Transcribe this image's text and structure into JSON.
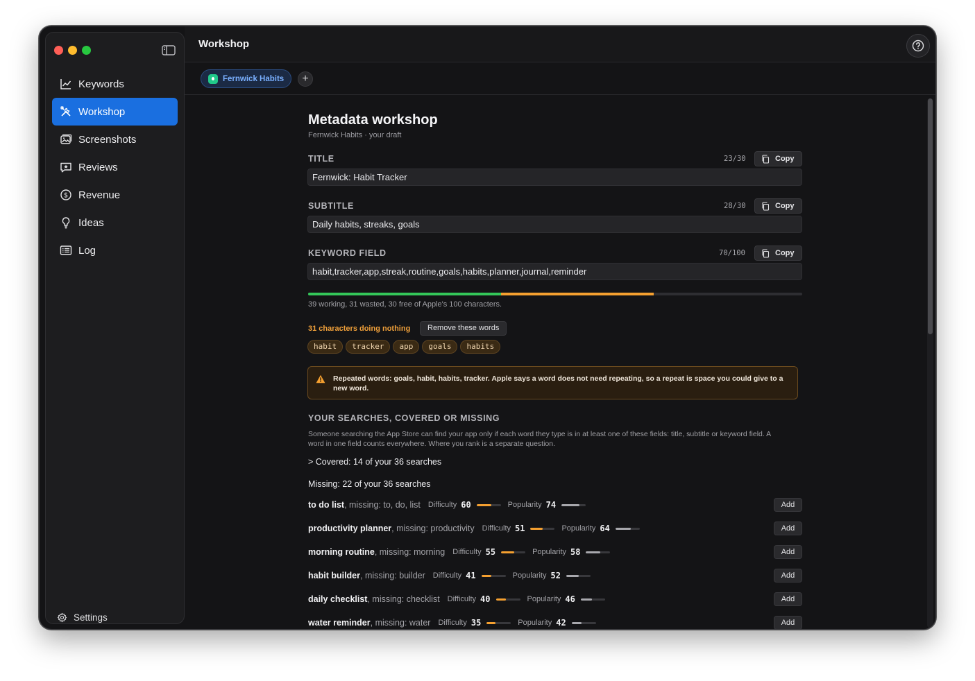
{
  "window": {
    "header_title": "Workshop"
  },
  "sidebar": {
    "items": [
      {
        "label": "Keywords",
        "icon": "chart-line-icon"
      },
      {
        "label": "Workshop",
        "icon": "tools-icon"
      },
      {
        "label": "Screenshots",
        "icon": "photos-icon"
      },
      {
        "label": "Reviews",
        "icon": "star-bubble-icon"
      },
      {
        "label": "Revenue",
        "icon": "dollar-circle-icon"
      },
      {
        "label": "Ideas",
        "icon": "lightbulb-icon"
      },
      {
        "label": "Log",
        "icon": "list-icon"
      }
    ],
    "active": "Workshop",
    "settings_label": "Settings"
  },
  "tabs": {
    "app_tab_label": "Fernwick Habits",
    "add_label": "+"
  },
  "workshop": {
    "title": "Metadata workshop",
    "subtitle": "Fernwick Habits · your draft",
    "copy_label": "Copy",
    "fields": {
      "title": {
        "label": "TITLE",
        "count": "23/30",
        "value": "Fernwick: Habit Tracker"
      },
      "subtitle": {
        "label": "SUBTITLE",
        "count": "28/30",
        "value": "Daily habits, streaks, goals"
      },
      "keywords": {
        "label": "KEYWORD FIELD",
        "count": "70/100",
        "value": "habit,tracker,app,streak,routine,goals,habits,planner,journal,reminder"
      }
    },
    "usage": {
      "working": 39,
      "wasted": 31,
      "free": 30,
      "total": 100,
      "working_color": "#34c759",
      "wasted_color": "#f5a030",
      "note": "39 working, 31 wasted, 30 free of Apple's 100 characters."
    },
    "waste": {
      "label": "31 characters doing nothing",
      "remove_label": "Remove these words",
      "chips": [
        "habit",
        "tracker",
        "app",
        "goals",
        "habits"
      ]
    },
    "warning": {
      "icon": "warning-triangle-icon",
      "color": "#f5a030",
      "text": "Repeated words: goals, habit, habits, tracker. Apple says a word does not need repeating, so a repeat is space you could give to a new word."
    },
    "searches": {
      "section_title": "YOUR SEARCHES, COVERED OR MISSING",
      "description": "Someone searching the App Store can find your app only if each word they type is in at least one of these fields: title, subtitle or keyword field. A word in one field counts everywhere. Where you rank is a separate question.",
      "covered_label": "> Covered: 14 of your 36 searches",
      "missing_label": "Missing: 22 of your 36 searches",
      "difficulty_label": "Difficulty",
      "popularity_label": "Popularity",
      "add_label": "Add",
      "missing": [
        {
          "term": "to do list",
          "missing": ", missing: to, do, list",
          "difficulty": 60,
          "popularity": 74
        },
        {
          "term": "productivity planner",
          "missing": ", missing: productivity",
          "difficulty": 51,
          "popularity": 64
        },
        {
          "term": "morning routine",
          "missing": ", missing: morning",
          "difficulty": 55,
          "popularity": 58
        },
        {
          "term": "habit builder",
          "missing": ", missing: builder",
          "difficulty": 41,
          "popularity": 52
        },
        {
          "term": "daily checklist",
          "missing": ", missing: checklist",
          "difficulty": 40,
          "popularity": 46
        },
        {
          "term": "water reminder",
          "missing": ", missing: water",
          "difficulty": 35,
          "popularity": 42
        }
      ]
    }
  }
}
